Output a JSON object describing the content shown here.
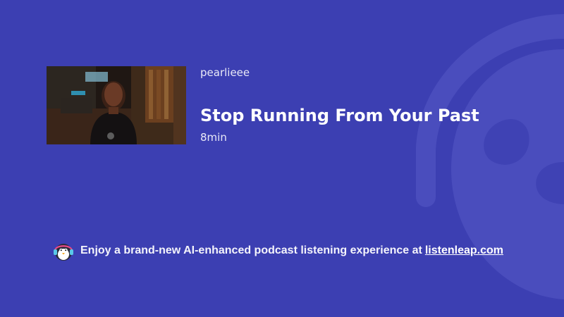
{
  "episode": {
    "author": "pearlieee",
    "title": "Stop Running From Your Past",
    "duration": "8min",
    "thumbnail_icon": "video-thumbnail-person"
  },
  "promo": {
    "text": "Enjoy a brand-new AI-enhanced podcast listening experience at",
    "link_text": "listenleap.com",
    "icon": "penguin-headphones-icon"
  },
  "colors": {
    "background": "#3c3fb2",
    "watermark": "#5557c0",
    "text": "#ffffff"
  }
}
